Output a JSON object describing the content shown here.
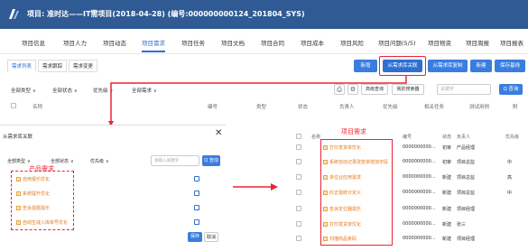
{
  "app": {
    "title": "项目: 准时达——IT需项目(2018-04-28) (编号:000000000124_201804_SYS)"
  },
  "nav": {
    "items": [
      "项目信息",
      "项目人力",
      "项目动态",
      "项目需求",
      "项目任务",
      "项目文档",
      "项目合同",
      "项目成本",
      "项目风险",
      "项目问题(5/5)",
      "项目物资",
      "项目周报",
      "项目报表"
    ],
    "active_index": 3
  },
  "subtabs": [
    "需求列表",
    "需求跟踪",
    "需求变更"
  ],
  "toolbar": {
    "btn_new_small": "新增",
    "btn_from_lib": "从需求库关联",
    "btn_from_lib_copy": "从需求库复制",
    "btn_new": "新建",
    "btn_save_template": "保存基线"
  },
  "filters": {
    "f1": "全部类型",
    "f2": "全部状态",
    "f3": "优先级",
    "f4": "全部需求"
  },
  "search": {
    "advanced": "高级查询",
    "my_searcher": "我的搜索器",
    "placeholder": "关键字",
    "button": "Q 查询"
  },
  "table": {
    "headers": [
      "名称",
      "编号",
      "类型",
      "状态",
      "负责人",
      "优先级",
      "相关任务",
      "测试用例",
      "附"
    ]
  },
  "dialog": {
    "title": "从需求库关联",
    "close": "✕",
    "filter_type": "全部类型",
    "filter_status": "全部状态",
    "filter_priority": "优先级",
    "search_placeholder": "请输入关键字",
    "search_button": "Q 查询",
    "label": "产品需求",
    "items": [
      "自用报乐优化",
      "系统提升优化",
      "告诉需题需乐",
      "自动生成入库单号优化"
    ],
    "ok": "保存",
    "cancel": "取消"
  },
  "right_panel": {
    "label": "项目需求",
    "header_name": "名称",
    "header_code": "编号",
    "header_status": "状态",
    "header_owner": "负责人",
    "header_priority": "优先级",
    "rows": [
      {
        "name": "打印发货单优化",
        "code": "0000000000...",
        "status": "初审",
        "owner": "产品经理",
        "priority": ""
      },
      {
        "name": "系统自动记录改变单增加字段",
        "code": "0000000000...",
        "status": "初审",
        "owner": "项目总监",
        "priority": "中"
      },
      {
        "name": "单位业应用需求",
        "code": "0000000000...",
        "status": "新建",
        "owner": "项目总监",
        "priority": "高"
      },
      {
        "name": "匹正需统计定义",
        "code": "0000000000...",
        "status": "新建",
        "owner": "项目总监",
        "priority": "中"
      },
      {
        "name": "告诉定位器需乐",
        "code": "0000000000...",
        "status": "新建",
        "owner": "项目经理",
        "priority": ""
      },
      {
        "name": "打印发货单优化",
        "code": "0000000000...",
        "status": "新建",
        "owner": "张三",
        "priority": ""
      },
      {
        "name": "扫描商品条码",
        "code": "0000000000...",
        "status": "新建",
        "owner": "项目经理",
        "priority": ""
      }
    ]
  },
  "colors": {
    "titlebar": "#2f5a94",
    "accent": "#2f6fd1",
    "highlight": "#e23",
    "folder_text": "#e4791c"
  }
}
